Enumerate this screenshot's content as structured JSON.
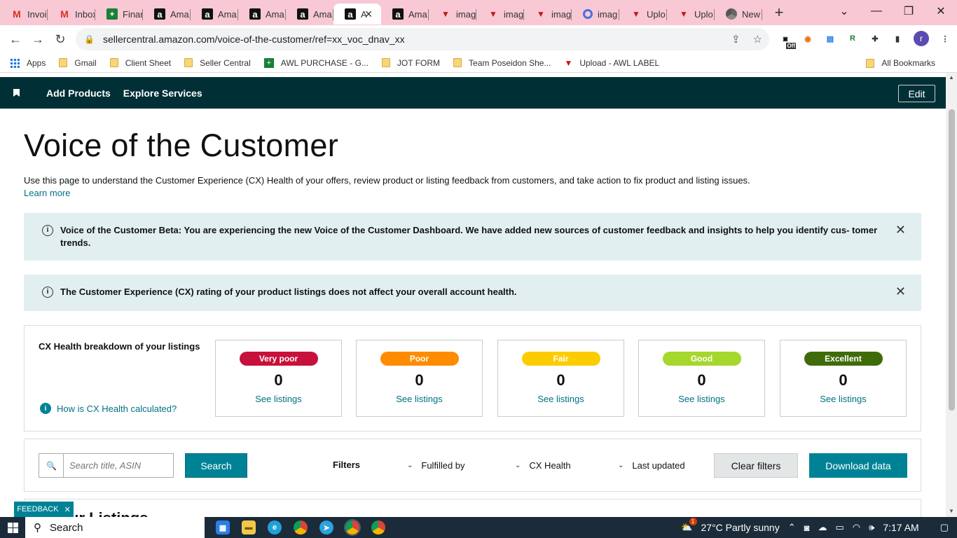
{
  "browser": {
    "tabs": [
      {
        "label": "Invoi",
        "icon": "gmail-icon"
      },
      {
        "label": "Inbox",
        "icon": "gmail-icon"
      },
      {
        "label": "Finan",
        "icon": "sheets-icon"
      },
      {
        "label": "Ama",
        "icon": "amazon-icon"
      },
      {
        "label": "Ama",
        "icon": "amazon-icon"
      },
      {
        "label": "Ama",
        "icon": "amazon-icon"
      },
      {
        "label": "Ama",
        "icon": "amazon-icon"
      },
      {
        "label": "A",
        "icon": "amazon-icon",
        "active": true
      },
      {
        "label": "Ama",
        "icon": "amazon-icon"
      },
      {
        "label": "imag",
        "icon": "v-icon"
      },
      {
        "label": "imag",
        "icon": "v-icon"
      },
      {
        "label": "imag",
        "icon": "v-icon"
      },
      {
        "label": "imag",
        "icon": "ring-icon"
      },
      {
        "label": "Uplo",
        "icon": "v-icon"
      },
      {
        "label": "Uplo",
        "icon": "v-icon"
      },
      {
        "label": "New",
        "icon": "chrome-icon"
      }
    ],
    "url": "sellercentral.amazon.com/voice-of-the-customer/ref=xx_voc_dnav_xx",
    "ext_off_label": "Off",
    "avatar_letter": "r",
    "bookmarks": [
      {
        "label": "Apps",
        "icon": "apps-icon"
      },
      {
        "label": "Gmail",
        "icon": "folder-icon"
      },
      {
        "label": "Client Sheet",
        "icon": "folder-icon"
      },
      {
        "label": "Seller Central",
        "icon": "folder-icon"
      },
      {
        "label": "AWL PURCHASE - G...",
        "icon": "sheets-icon"
      },
      {
        "label": "JOT FORM",
        "icon": "folder-icon"
      },
      {
        "label": "Team Poseidon She...",
        "icon": "folder-icon"
      },
      {
        "label": "Upload - AWL LABEL",
        "icon": "v-icon"
      }
    ],
    "all_bookmarks": "All Bookmarks"
  },
  "seller_nav": {
    "links": [
      "Add Products",
      "Explore Services"
    ],
    "edit_label": "Edit"
  },
  "page": {
    "title": "Voice of the Customer",
    "intro": "Use this page to understand the Customer Experience (CX) Health of your offers, review product or listing feedback from customers, and take action to fix product and listing issues.",
    "learn_more": "Learn more",
    "alert_beta": "Voice of the Customer Beta: You are experiencing the new Voice of the Customer Dashboard. We have added new sources of customer feedback and insights to help you identify cus- tomer trends.",
    "alert_rating": "The Customer Experience (CX) rating of your product listings does not affect your overall account health."
  },
  "cx_health": {
    "title": "CX Health breakdown of your listings",
    "how_link": "How is CX Health calculated?",
    "cards": [
      {
        "label": "Very poor",
        "count": "0",
        "link": "See listings",
        "color": "#c7113a"
      },
      {
        "label": "Poor",
        "count": "0",
        "link": "See listings",
        "color": "#ff8c00"
      },
      {
        "label": "Fair",
        "count": "0",
        "link": "See listings",
        "color": "#fccc00"
      },
      {
        "label": "Good",
        "count": "0",
        "link": "See listings",
        "color": "#a6d72c"
      },
      {
        "label": "Excellent",
        "count": "0",
        "link": "See listings",
        "color": "#3f6b0a"
      }
    ]
  },
  "filters": {
    "search_placeholder": "Search title, ASIN",
    "search_button": "Search",
    "filters_label": "Filters",
    "dropdowns": [
      "Fulfilled by",
      "CX Health",
      "Last updated"
    ],
    "clear_button": "Clear filters",
    "download_button": "Download data"
  },
  "listings": {
    "title_partial": "ur Listings"
  },
  "feedback_label": "FEEDBACK",
  "taskbar": {
    "search_label": "Search",
    "weather": "27°C  Partly sunny",
    "notification_count": "1",
    "time": "7:17 AM"
  }
}
